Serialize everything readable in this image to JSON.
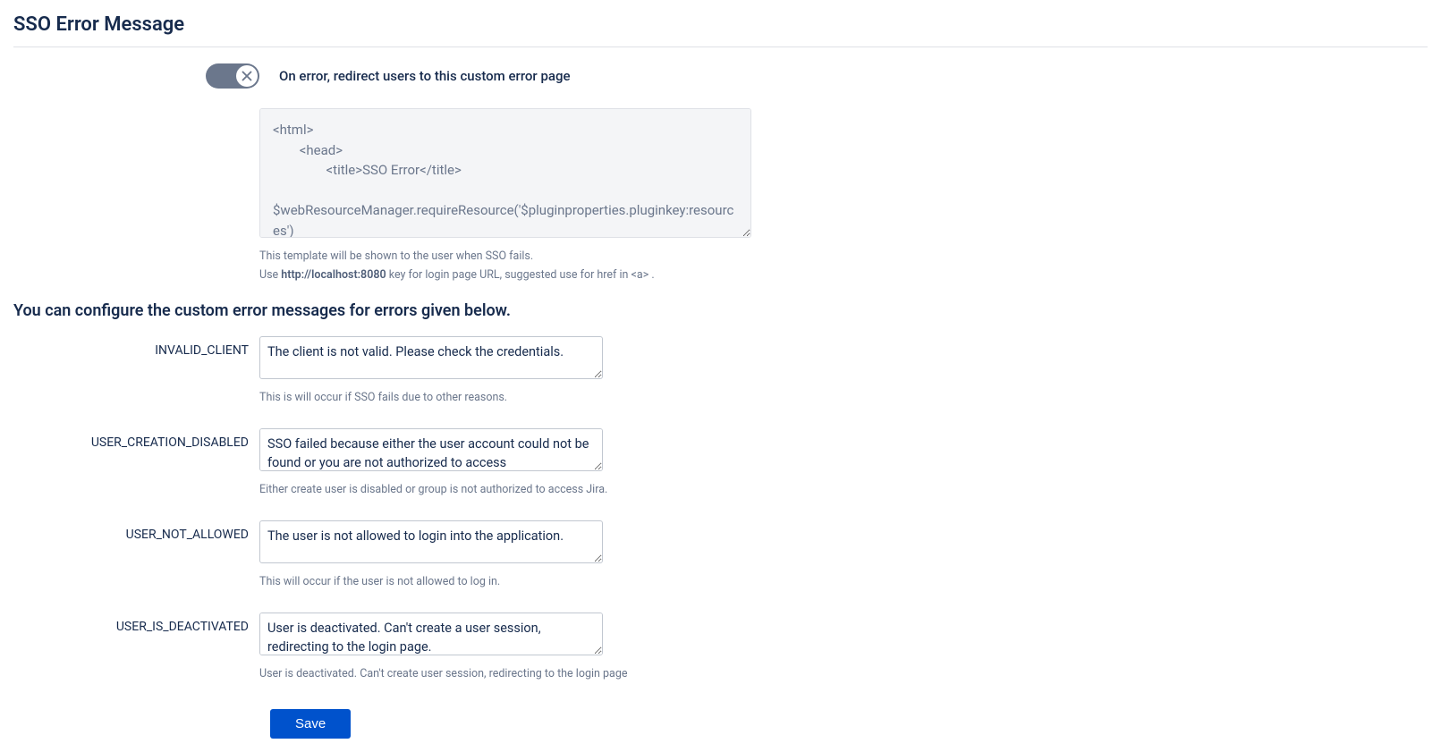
{
  "page_title": "SSO Error Message",
  "toggle": {
    "enabled": false,
    "description": "On error, redirect users to this custom error page"
  },
  "template": {
    "value": "<html>\n        <head>\n                <title>SSO Error</title>\n\n$webResourceManager.requireResource('$pluginproperties.pluginkey:resources')",
    "help_line1": "This template will be shown to the user when SSO fails.",
    "help_line2_prefix": "Use ",
    "help_line2_url": "http://localhost:8080",
    "help_line2_suffix": " key for login page URL, suggested use for href in <a> ."
  },
  "subheading": "You can configure the custom error messages for errors given below.",
  "errors": {
    "invalid_client": {
      "label": "INVALID_CLIENT",
      "value": "The client is not valid. Please check the credentials.",
      "help": "This is will occur if SSO fails due to other reasons."
    },
    "user_creation_disabled": {
      "label": "USER_CREATION_DISABLED",
      "value": "SSO failed because either the user account could not be found or you are not authorized to access",
      "help": "Either create user is disabled or group is not authorized to access Jira."
    },
    "user_not_allowed": {
      "label": "USER_NOT_ALLOWED",
      "value": "The user is not allowed to login into the application.",
      "help": "This will occur if the user is not allowed to log in."
    },
    "user_is_deactivated": {
      "label": "USER_IS_DEACTIVATED",
      "value": "User is deactivated. Can't create a user session, redirecting to the login page.",
      "help": "User is deactivated. Can't create user session, redirecting to the login page"
    }
  },
  "save_button": "Save"
}
